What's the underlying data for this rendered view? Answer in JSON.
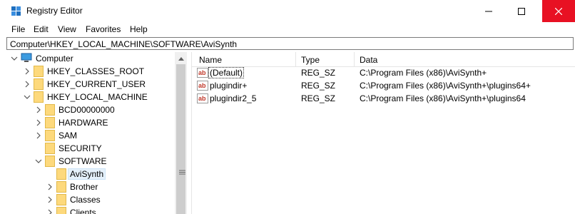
{
  "window": {
    "title": "Registry Editor",
    "controls": {
      "minimize": "minimize",
      "maximize": "maximize",
      "close": "close"
    },
    "accent_close": "#e81123"
  },
  "menu": {
    "items": [
      {
        "label": "File"
      },
      {
        "label": "Edit"
      },
      {
        "label": "View"
      },
      {
        "label": "Favorites"
      },
      {
        "label": "Help"
      }
    ]
  },
  "address": {
    "path": "Computer\\HKEY_LOCAL_MACHINE\\SOFTWARE\\AviSynth"
  },
  "tree": {
    "root": "Computer",
    "items": [
      {
        "label": "HKEY_CLASSES_ROOT",
        "expanded": false
      },
      {
        "label": "HKEY_CURRENT_USER",
        "expanded": false
      },
      {
        "label": "HKEY_LOCAL_MACHINE",
        "expanded": true
      },
      {
        "label": "BCD00000000",
        "expanded": false
      },
      {
        "label": "HARDWARE",
        "expanded": false
      },
      {
        "label": "SAM",
        "expanded": false
      },
      {
        "label": "SECURITY",
        "expanded": false
      },
      {
        "label": "SOFTWARE",
        "expanded": true
      },
      {
        "label": "AviSynth",
        "selected": true
      },
      {
        "label": "Brother",
        "expanded": false
      },
      {
        "label": "Classes",
        "expanded": false
      },
      {
        "label": "Clients",
        "expanded": false
      }
    ]
  },
  "list": {
    "columns": {
      "name": "Name",
      "type": "Type",
      "data": "Data"
    },
    "rows": [
      {
        "name": "(Default)",
        "type": "REG_SZ",
        "data": "C:\\Program Files (x86)\\AviSynth+"
      },
      {
        "name": "plugindir+",
        "type": "REG_SZ",
        "data": "C:\\Program Files (x86)\\AviSynth+\\plugins64+"
      },
      {
        "name": "plugindir2_5",
        "type": "REG_SZ",
        "data": "C:\\Program Files (x86)\\AviSynth+\\plugins64"
      }
    ]
  }
}
